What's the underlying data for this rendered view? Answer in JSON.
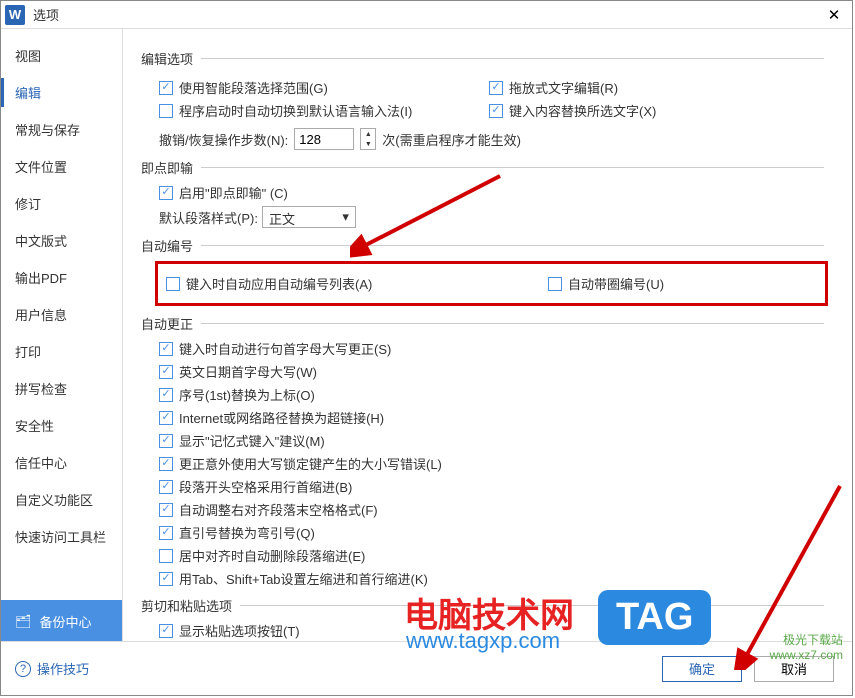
{
  "title": "选项",
  "nav": [
    "视图",
    "编辑",
    "常规与保存",
    "文件位置",
    "修订",
    "中文版式",
    "输出PDF",
    "用户信息",
    "打印",
    "拼写检查",
    "安全性",
    "信任中心",
    "自定义功能区",
    "快速访问工具栏"
  ],
  "backup": "备份中心",
  "groups": {
    "edit": "编辑选项",
    "click": "即点即输",
    "autonum": "自动编号",
    "autofix": "自动更正",
    "paste": "剪切和粘贴选项"
  },
  "opts": {
    "smartSel": "使用智能段落选择范围(G)",
    "dragText": "拖放式文字编辑(R)",
    "imeSwitch": "程序启动时自动切换到默认语言输入法(I)",
    "replSel": "键入内容替换所选文字(X)",
    "undoLabel": "撤销/恢复操作步数(N):",
    "undoVal": "128",
    "undoSuffix": "次(需重启程序才能生效)",
    "enableClick": "启用\"即点即输\" (C)",
    "paraStyleLabel": "默认段落样式(P):",
    "paraStyleVal": "正文",
    "autoNumList": "键入时自动应用自动编号列表(A)",
    "autoCircle": "自动带圈编号(U)",
    "capFirst": "键入时自动进行句首字母大写更正(S)",
    "capDay": "英文日期首字母大写(W)",
    "ordSup": "序号(1st)替换为上标(O)",
    "urlLink": "Internet或网络路径替换为超链接(H)",
    "memType": "显示\"记忆式键入\"建议(M)",
    "capsErr": "更正意外使用大写锁定键产生的大小写错误(L)",
    "indentSpace": "段落开头空格采用行首缩进(B)",
    "rightAlign": "自动调整右对齐段落末空格格式(F)",
    "quotes": "直引号替换为弯引号(Q)",
    "delIndent": "居中对齐时自动删除段落缩进(E)",
    "tabIndent": "用Tab、Shift+Tab设置左缩进和首行缩进(K)",
    "showPaste": "显示粘贴选项按钮(T)"
  },
  "footer": {
    "help": "操作技巧",
    "ok": "确定",
    "cancel": "取消"
  },
  "watermark": {
    "title": "电脑技术网",
    "url": "www.tagxp.com",
    "tag": "TAG",
    "dl1": "极光下载站",
    "dl2": "www.xz7.com"
  }
}
